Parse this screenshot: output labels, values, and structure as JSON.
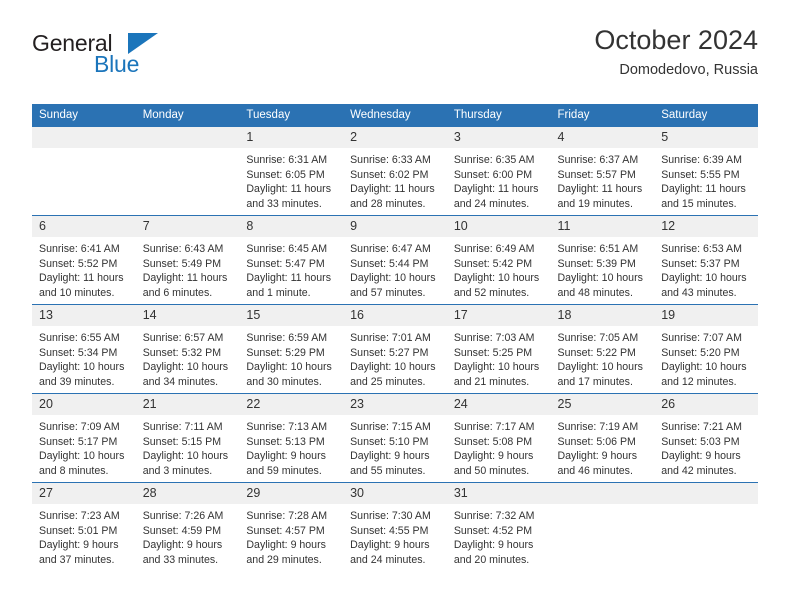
{
  "brand": {
    "name_part1": "General",
    "name_part2": "Blue",
    "accent_color": "#1b75bb"
  },
  "header": {
    "title": "October 2024",
    "subtitle": "Domodedovo, Russia"
  },
  "theme": {
    "header_blue": "#2b72b3",
    "daynum_band": "#f0f0f0",
    "text": "#333333"
  },
  "weekday_headers": [
    "Sunday",
    "Monday",
    "Tuesday",
    "Wednesday",
    "Thursday",
    "Friday",
    "Saturday"
  ],
  "labels": {
    "sunrise": "Sunrise:",
    "sunset": "Sunset:",
    "daylight": "Daylight:"
  },
  "weeks": [
    [
      {
        "day": "",
        "sunrise": "",
        "sunset": "",
        "daylight_line1": "",
        "daylight_line2": "",
        "empty": true
      },
      {
        "day": "",
        "sunrise": "",
        "sunset": "",
        "daylight_line1": "",
        "daylight_line2": "",
        "empty": true
      },
      {
        "day": "1",
        "sunrise": "Sunrise: 6:31 AM",
        "sunset": "Sunset: 6:05 PM",
        "daylight_line1": "Daylight: 11 hours",
        "daylight_line2": "and 33 minutes."
      },
      {
        "day": "2",
        "sunrise": "Sunrise: 6:33 AM",
        "sunset": "Sunset: 6:02 PM",
        "daylight_line1": "Daylight: 11 hours",
        "daylight_line2": "and 28 minutes."
      },
      {
        "day": "3",
        "sunrise": "Sunrise: 6:35 AM",
        "sunset": "Sunset: 6:00 PM",
        "daylight_line1": "Daylight: 11 hours",
        "daylight_line2": "and 24 minutes."
      },
      {
        "day": "4",
        "sunrise": "Sunrise: 6:37 AM",
        "sunset": "Sunset: 5:57 PM",
        "daylight_line1": "Daylight: 11 hours",
        "daylight_line2": "and 19 minutes."
      },
      {
        "day": "5",
        "sunrise": "Sunrise: 6:39 AM",
        "sunset": "Sunset: 5:55 PM",
        "daylight_line1": "Daylight: 11 hours",
        "daylight_line2": "and 15 minutes."
      }
    ],
    [
      {
        "day": "6",
        "sunrise": "Sunrise: 6:41 AM",
        "sunset": "Sunset: 5:52 PM",
        "daylight_line1": "Daylight: 11 hours",
        "daylight_line2": "and 10 minutes."
      },
      {
        "day": "7",
        "sunrise": "Sunrise: 6:43 AM",
        "sunset": "Sunset: 5:49 PM",
        "daylight_line1": "Daylight: 11 hours",
        "daylight_line2": "and 6 minutes."
      },
      {
        "day": "8",
        "sunrise": "Sunrise: 6:45 AM",
        "sunset": "Sunset: 5:47 PM",
        "daylight_line1": "Daylight: 11 hours",
        "daylight_line2": "and 1 minute."
      },
      {
        "day": "9",
        "sunrise": "Sunrise: 6:47 AM",
        "sunset": "Sunset: 5:44 PM",
        "daylight_line1": "Daylight: 10 hours",
        "daylight_line2": "and 57 minutes."
      },
      {
        "day": "10",
        "sunrise": "Sunrise: 6:49 AM",
        "sunset": "Sunset: 5:42 PM",
        "daylight_line1": "Daylight: 10 hours",
        "daylight_line2": "and 52 minutes."
      },
      {
        "day": "11",
        "sunrise": "Sunrise: 6:51 AM",
        "sunset": "Sunset: 5:39 PM",
        "daylight_line1": "Daylight: 10 hours",
        "daylight_line2": "and 48 minutes."
      },
      {
        "day": "12",
        "sunrise": "Sunrise: 6:53 AM",
        "sunset": "Sunset: 5:37 PM",
        "daylight_line1": "Daylight: 10 hours",
        "daylight_line2": "and 43 minutes."
      }
    ],
    [
      {
        "day": "13",
        "sunrise": "Sunrise: 6:55 AM",
        "sunset": "Sunset: 5:34 PM",
        "daylight_line1": "Daylight: 10 hours",
        "daylight_line2": "and 39 minutes."
      },
      {
        "day": "14",
        "sunrise": "Sunrise: 6:57 AM",
        "sunset": "Sunset: 5:32 PM",
        "daylight_line1": "Daylight: 10 hours",
        "daylight_line2": "and 34 minutes."
      },
      {
        "day": "15",
        "sunrise": "Sunrise: 6:59 AM",
        "sunset": "Sunset: 5:29 PM",
        "daylight_line1": "Daylight: 10 hours",
        "daylight_line2": "and 30 minutes."
      },
      {
        "day": "16",
        "sunrise": "Sunrise: 7:01 AM",
        "sunset": "Sunset: 5:27 PM",
        "daylight_line1": "Daylight: 10 hours",
        "daylight_line2": "and 25 minutes."
      },
      {
        "day": "17",
        "sunrise": "Sunrise: 7:03 AM",
        "sunset": "Sunset: 5:25 PM",
        "daylight_line1": "Daylight: 10 hours",
        "daylight_line2": "and 21 minutes."
      },
      {
        "day": "18",
        "sunrise": "Sunrise: 7:05 AM",
        "sunset": "Sunset: 5:22 PM",
        "daylight_line1": "Daylight: 10 hours",
        "daylight_line2": "and 17 minutes."
      },
      {
        "day": "19",
        "sunrise": "Sunrise: 7:07 AM",
        "sunset": "Sunset: 5:20 PM",
        "daylight_line1": "Daylight: 10 hours",
        "daylight_line2": "and 12 minutes."
      }
    ],
    [
      {
        "day": "20",
        "sunrise": "Sunrise: 7:09 AM",
        "sunset": "Sunset: 5:17 PM",
        "daylight_line1": "Daylight: 10 hours",
        "daylight_line2": "and 8 minutes."
      },
      {
        "day": "21",
        "sunrise": "Sunrise: 7:11 AM",
        "sunset": "Sunset: 5:15 PM",
        "daylight_line1": "Daylight: 10 hours",
        "daylight_line2": "and 3 minutes."
      },
      {
        "day": "22",
        "sunrise": "Sunrise: 7:13 AM",
        "sunset": "Sunset: 5:13 PM",
        "daylight_line1": "Daylight: 9 hours",
        "daylight_line2": "and 59 minutes."
      },
      {
        "day": "23",
        "sunrise": "Sunrise: 7:15 AM",
        "sunset": "Sunset: 5:10 PM",
        "daylight_line1": "Daylight: 9 hours",
        "daylight_line2": "and 55 minutes."
      },
      {
        "day": "24",
        "sunrise": "Sunrise: 7:17 AM",
        "sunset": "Sunset: 5:08 PM",
        "daylight_line1": "Daylight: 9 hours",
        "daylight_line2": "and 50 minutes."
      },
      {
        "day": "25",
        "sunrise": "Sunrise: 7:19 AM",
        "sunset": "Sunset: 5:06 PM",
        "daylight_line1": "Daylight: 9 hours",
        "daylight_line2": "and 46 minutes."
      },
      {
        "day": "26",
        "sunrise": "Sunrise: 7:21 AM",
        "sunset": "Sunset: 5:03 PM",
        "daylight_line1": "Daylight: 9 hours",
        "daylight_line2": "and 42 minutes."
      }
    ],
    [
      {
        "day": "27",
        "sunrise": "Sunrise: 7:23 AM",
        "sunset": "Sunset: 5:01 PM",
        "daylight_line1": "Daylight: 9 hours",
        "daylight_line2": "and 37 minutes."
      },
      {
        "day": "28",
        "sunrise": "Sunrise: 7:26 AM",
        "sunset": "Sunset: 4:59 PM",
        "daylight_line1": "Daylight: 9 hours",
        "daylight_line2": "and 33 minutes."
      },
      {
        "day": "29",
        "sunrise": "Sunrise: 7:28 AM",
        "sunset": "Sunset: 4:57 PM",
        "daylight_line1": "Daylight: 9 hours",
        "daylight_line2": "and 29 minutes."
      },
      {
        "day": "30",
        "sunrise": "Sunrise: 7:30 AM",
        "sunset": "Sunset: 4:55 PM",
        "daylight_line1": "Daylight: 9 hours",
        "daylight_line2": "and 24 minutes."
      },
      {
        "day": "31",
        "sunrise": "Sunrise: 7:32 AM",
        "sunset": "Sunset: 4:52 PM",
        "daylight_line1": "Daylight: 9 hours",
        "daylight_line2": "and 20 minutes."
      },
      {
        "day": "",
        "sunrise": "",
        "sunset": "",
        "daylight_line1": "",
        "daylight_line2": "",
        "empty": true
      },
      {
        "day": "",
        "sunrise": "",
        "sunset": "",
        "daylight_line1": "",
        "daylight_line2": "",
        "empty": true
      }
    ]
  ]
}
